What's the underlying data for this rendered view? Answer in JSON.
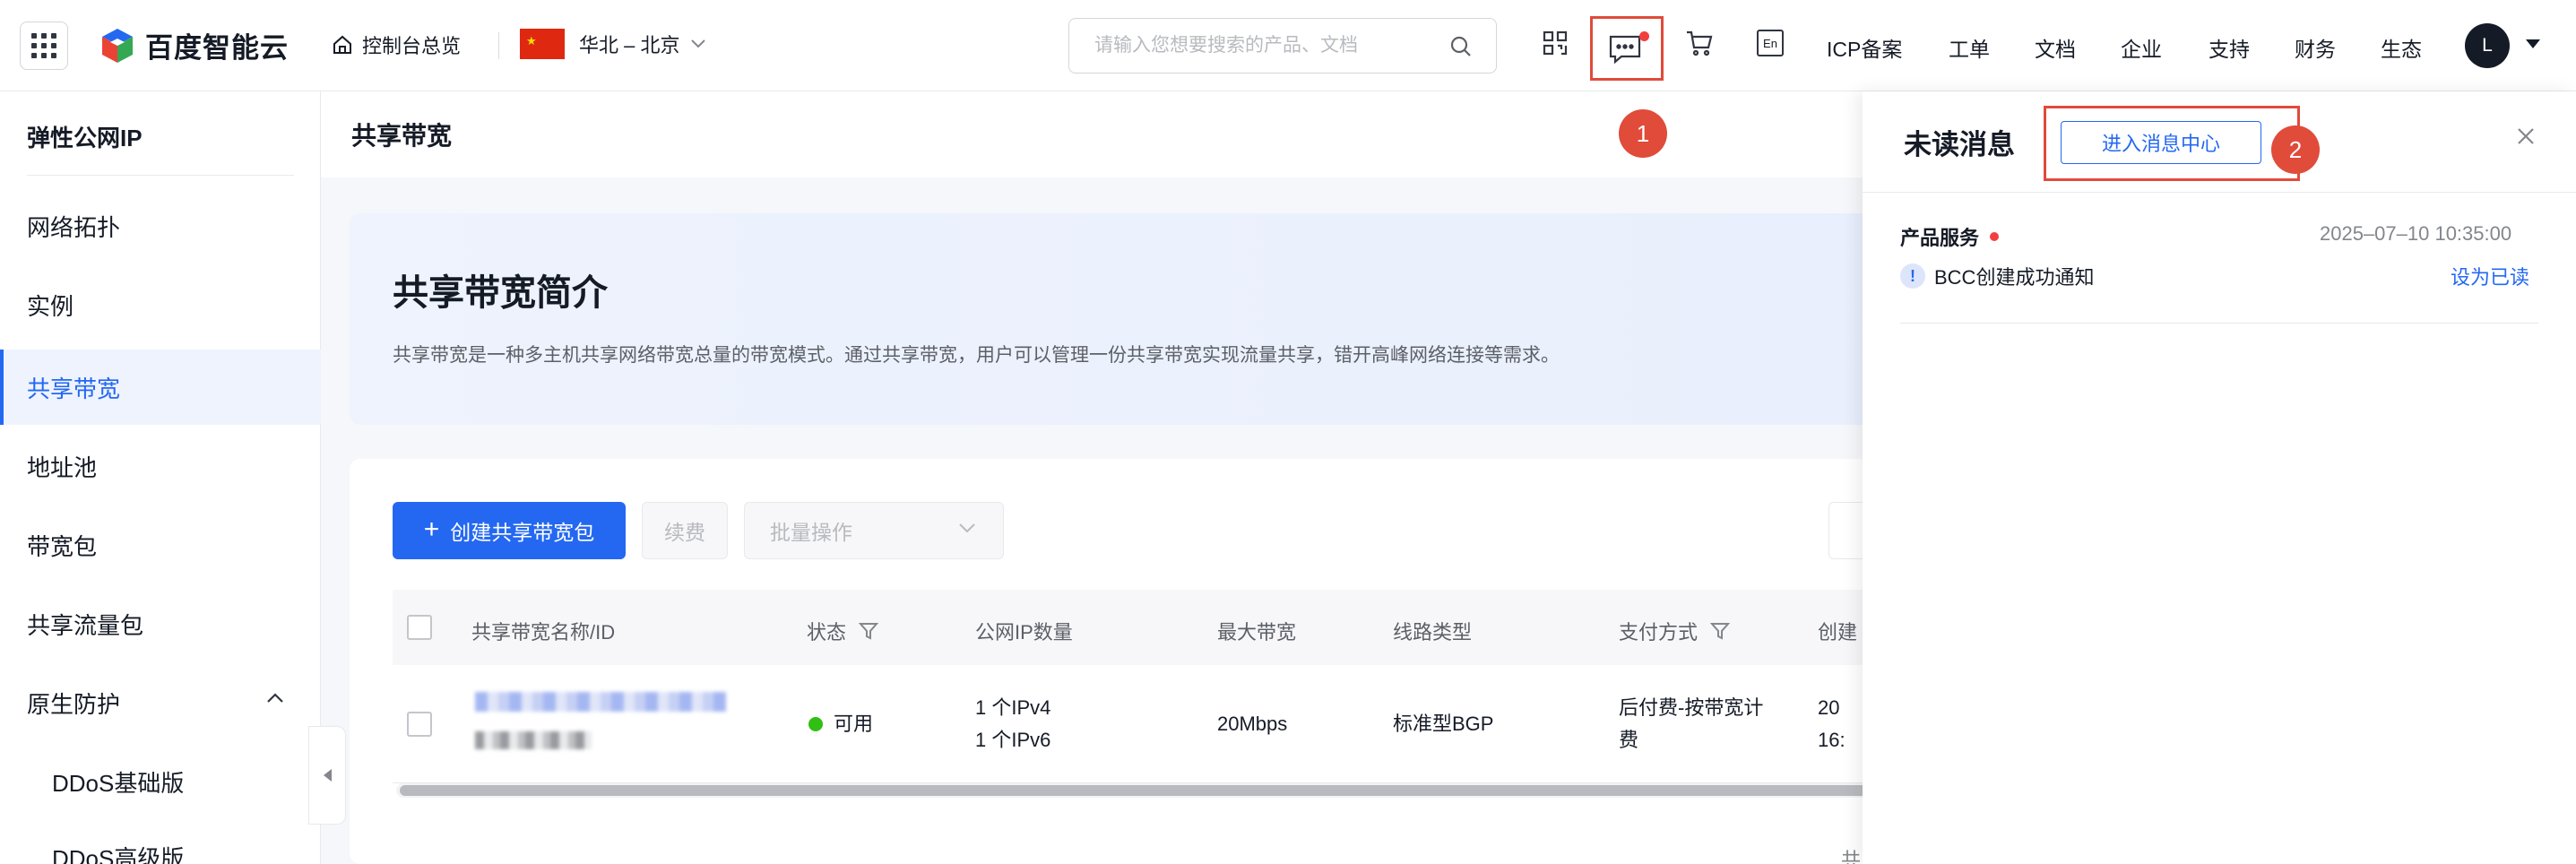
{
  "header": {
    "brand": "百度智能云",
    "home_label": "控制台总览",
    "region": "华北 – 北京",
    "search_placeholder": "请输入您想要搜索的产品、文档",
    "lang_icon_text": "En",
    "nav_links": [
      "ICP备案",
      "工单",
      "文档",
      "企业",
      "支持",
      "财务",
      "生态"
    ],
    "avatar_letter": "L",
    "icons": [
      "grid-icon",
      "home-icon",
      "chevron-down-icon",
      "search-icon",
      "qrcode-icon",
      "message-icon",
      "cart-icon",
      "language-icon",
      "caret-down-icon"
    ]
  },
  "sidebar": {
    "title": "弹性公网IP",
    "items": [
      {
        "label": "网络拓扑"
      },
      {
        "label": "实例"
      },
      {
        "label": "共享带宽",
        "active": true
      },
      {
        "label": "地址池"
      },
      {
        "label": "带宽包"
      },
      {
        "label": "共享流量包"
      },
      {
        "label": "原生防护",
        "expanded": true
      },
      {
        "label": "DDoS基础版"
      },
      {
        "label": "DDoS高级版"
      }
    ]
  },
  "main": {
    "page_title": "共享带宽",
    "intro_title": "共享带宽简介",
    "intro_desc": "共享带宽是一种多主机共享网络带宽总量的带宽模式。通过共享带宽，用户可以管理一份共享带宽实现流量共享，错开高峰网络连接等需求。",
    "create_button": "创建共享带宽包",
    "renew_button": "续费",
    "batch_button": "批量操作",
    "columns": [
      "共享带宽名称/ID",
      "状态",
      "公网IP数量",
      "最大带宽",
      "线路类型",
      "支付方式",
      "创建"
    ],
    "rows": [
      {
        "status": "可用",
        "ip_count_v4": "1 个IPv4",
        "ip_count_v6": "1 个IPv6",
        "max_bandwidth": "20Mbps",
        "line_type": "标准型BGP",
        "payment_line1": "后付费-按带宽计",
        "payment_line2": "费",
        "created_line1": "20",
        "created_line2": "16:"
      }
    ],
    "footer_text": "共"
  },
  "drawer": {
    "title": "未读消息",
    "center_button": "进入消息中心",
    "messages": [
      {
        "category": "产品服务",
        "time": "2025–07–10 10:35:00",
        "title": "BCC创建成功通知",
        "action": "设为已读"
      }
    ]
  },
  "annotations": {
    "badge1": "1",
    "badge2": "2",
    "highlight_color": "#e04b3a"
  },
  "colors": {
    "primary": "#2468f2",
    "status_ok": "#30bf13",
    "unread_dot": "#f33e3e"
  }
}
